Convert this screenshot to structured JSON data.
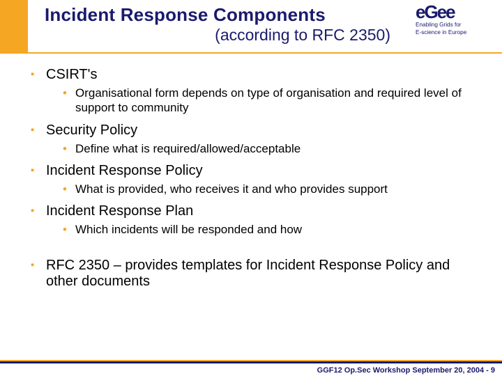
{
  "header": {
    "title": "Incident Response Components",
    "subtitle": "(according to RFC 2350)"
  },
  "logo": {
    "text": "eGee",
    "tagline1": "Enabling Grids for",
    "tagline2": "E-science in Europe"
  },
  "bullets": {
    "b1": "CSIRT's",
    "b1s": "Organisational form depends on type of organisation and required level of support to community",
    "b2": "Security Policy",
    "b2s": "Define what is required/allowed/acceptable",
    "b3": "Incident Response Policy",
    "b3s": "What is provided, who receives it and who provides support",
    "b4": "Incident Response Plan",
    "b4s": "Which incidents will be responded and how",
    "b5": "RFC 2350 – provides templates for Incident Response Policy and other documents"
  },
  "footer": {
    "text": "GGF12 Op.Sec Workshop September 20, 2004  - 9"
  }
}
